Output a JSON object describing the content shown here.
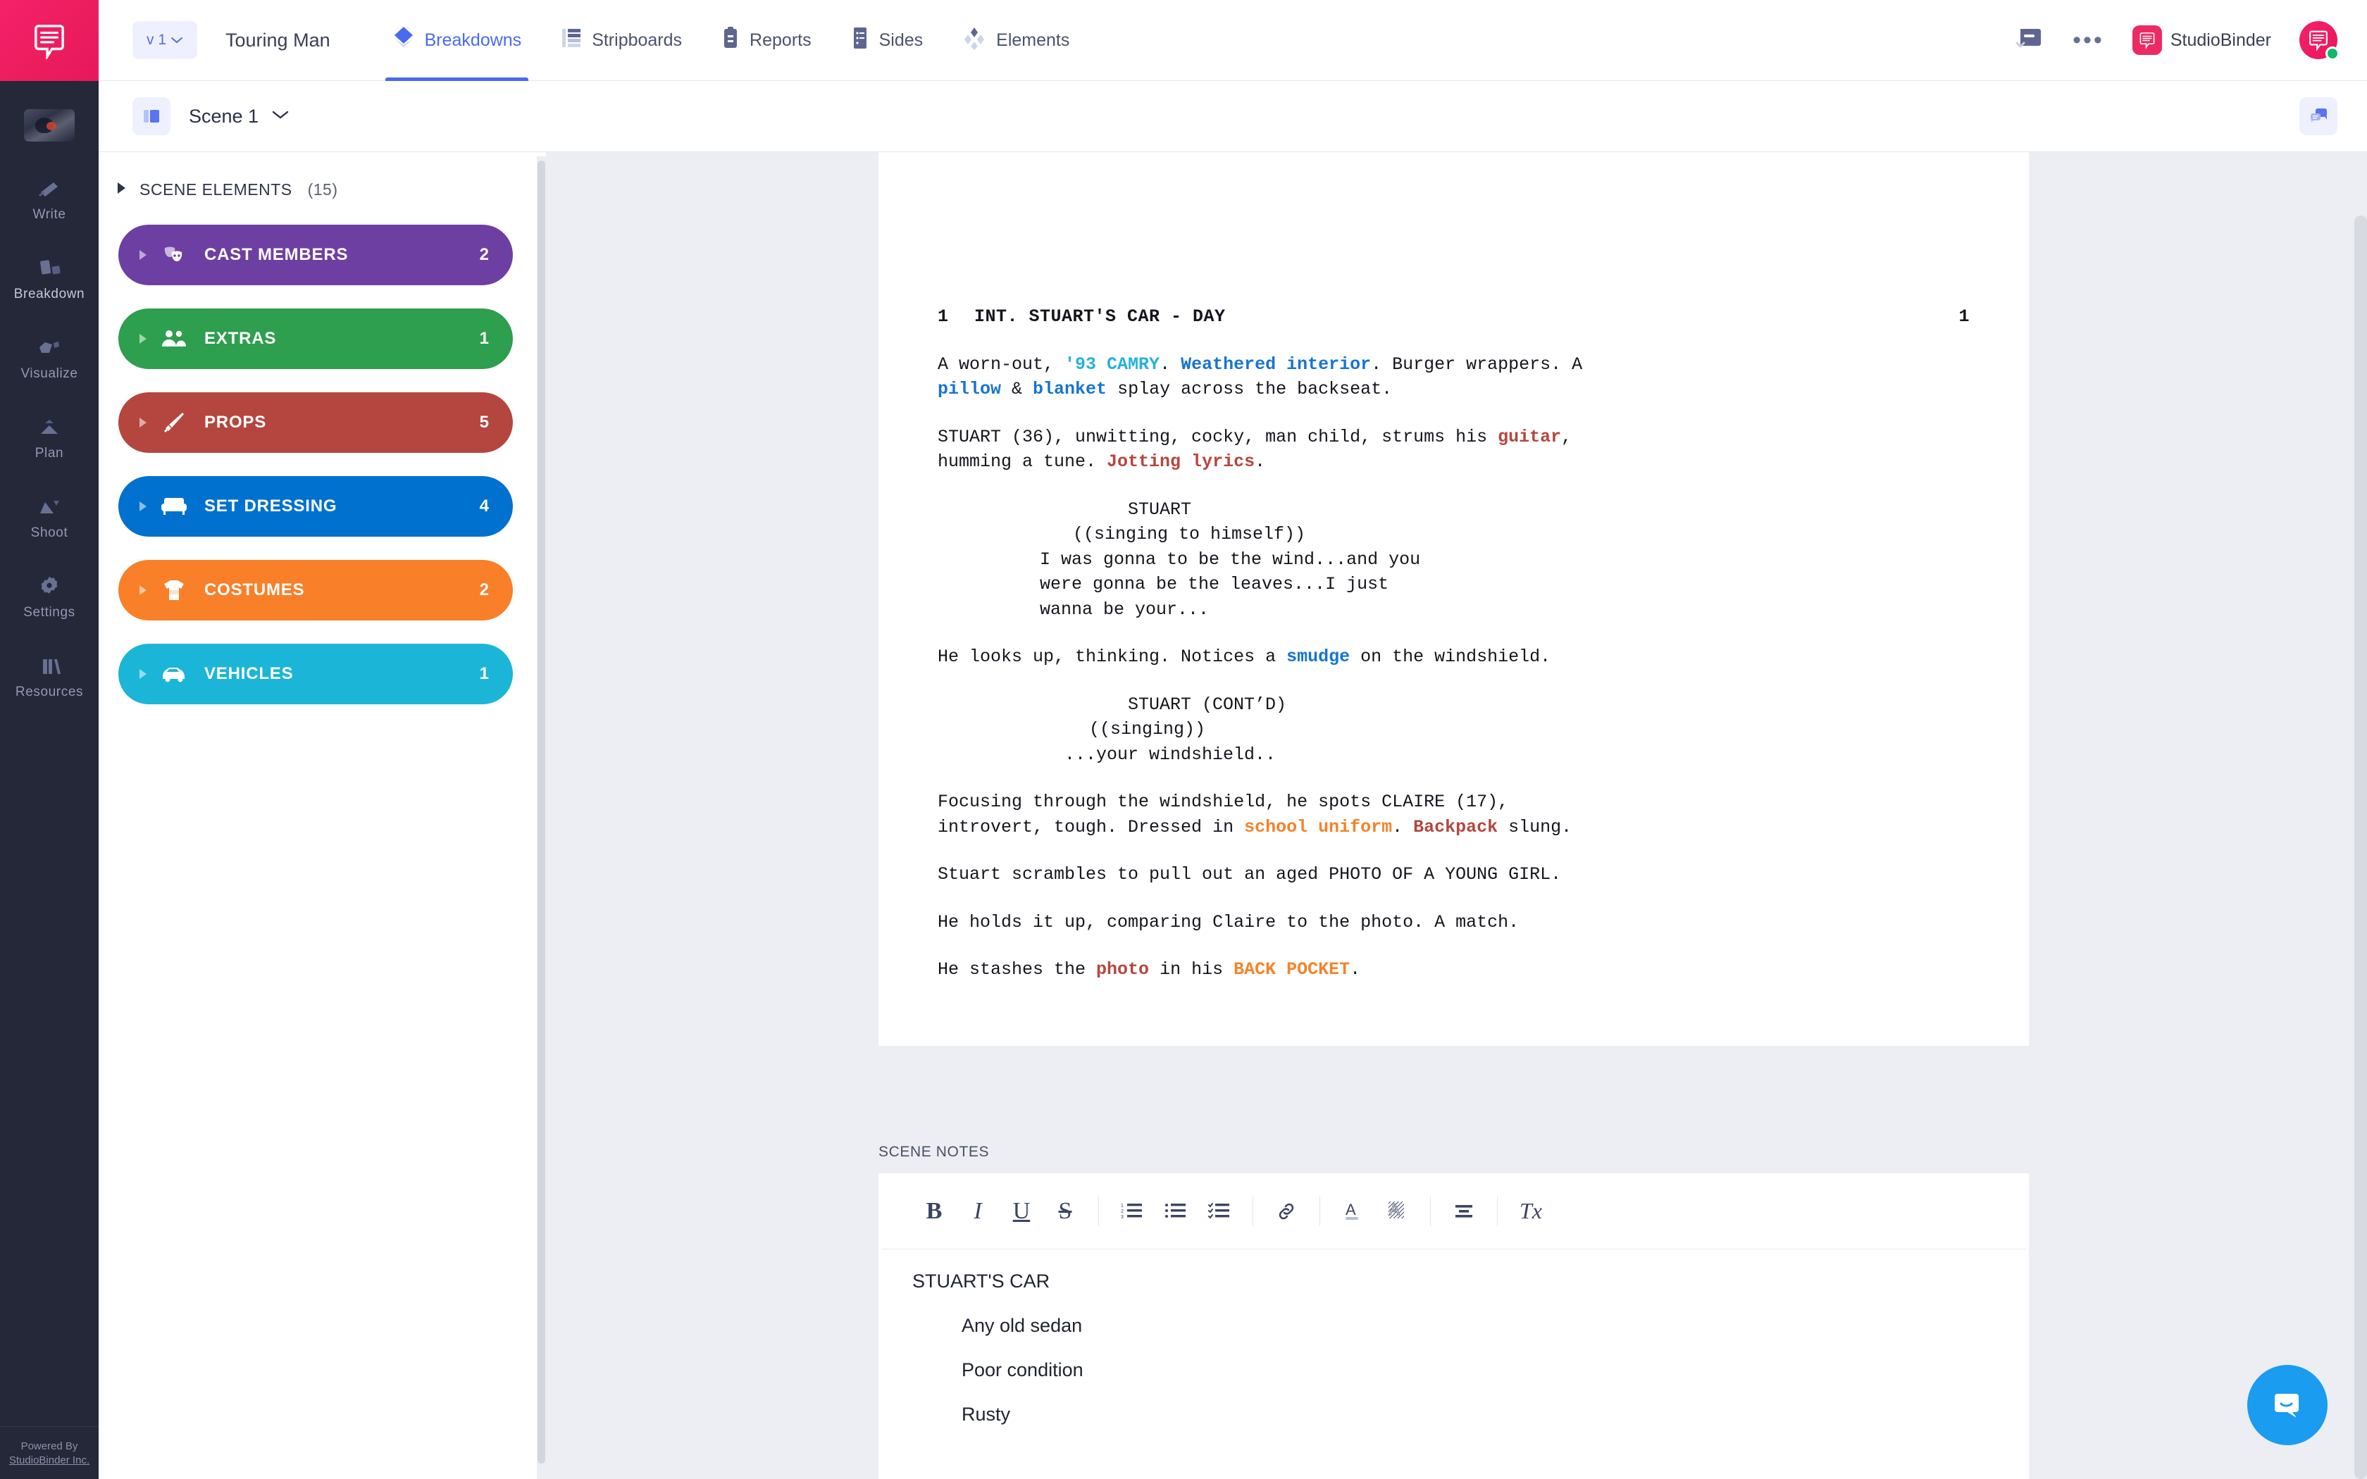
{
  "rail": {
    "logo_icon": "studiobinder-logo-icon",
    "thumbnail_name": "project-thumbnail",
    "items": [
      {
        "label": "Write",
        "icon": "write-icon"
      },
      {
        "label": "Breakdown",
        "icon": "breakdown-icon"
      },
      {
        "label": "Visualize",
        "icon": "visualize-icon"
      },
      {
        "label": "Plan",
        "icon": "plan-icon"
      },
      {
        "label": "Shoot",
        "icon": "shoot-icon"
      },
      {
        "label": "Settings",
        "icon": "gear-icon"
      },
      {
        "label": "Resources",
        "icon": "resources-icon"
      }
    ],
    "footer_line1": "Powered By",
    "footer_line2": "StudioBinder Inc."
  },
  "topbar": {
    "version_label": "v 1",
    "project_title": "Touring Man",
    "nav": [
      {
        "label": "Breakdowns",
        "icon": "diamond-icon",
        "active": true
      },
      {
        "label": "Stripboards",
        "icon": "stripboard-icon",
        "active": false
      },
      {
        "label": "Reports",
        "icon": "clipboard-icon",
        "active": false
      },
      {
        "label": "Sides",
        "icon": "sides-icon",
        "active": false
      },
      {
        "label": "Elements",
        "icon": "elements-icon",
        "active": false
      }
    ],
    "notification_icon": "inbox-check-icon",
    "more_label": "•••",
    "account_name": "StudioBinder",
    "account_chip_icon": "studiobinder-mark-icon",
    "avatar_icon": "user-avatar",
    "accent_color": "#4a6af0",
    "brand_color": "#ec2a63"
  },
  "scenebar": {
    "icon": "scene-card-icon",
    "scene_label": "Scene 1",
    "chevron_icon": "chevron-down-icon",
    "comments_icon": "comments-icon"
  },
  "elements_panel": {
    "header_label": "SCENE ELEMENTS",
    "header_count": "(15)",
    "expand_icon": "triangle-right-icon",
    "categories": [
      {
        "label": "CAST MEMBERS",
        "count": "2",
        "color": "#6e3fa3",
        "icon": "masks-icon"
      },
      {
        "label": "EXTRAS",
        "count": "1",
        "color": "#2e9e4f",
        "icon": "people-icon"
      },
      {
        "label": "PROPS",
        "count": "5",
        "color": "#b5463f",
        "icon": "sword-icon"
      },
      {
        "label": "SET DRESSING",
        "count": "4",
        "color": "#0071ce",
        "icon": "sofa-icon"
      },
      {
        "label": "COSTUMES",
        "count": "2",
        "color": "#f97f28",
        "icon": "shirt-icon"
      },
      {
        "label": "VEHICLES",
        "count": "1",
        "color": "#1bb5d8",
        "icon": "car-icon"
      }
    ]
  },
  "script": {
    "scene_number_left": "1",
    "scene_number_right": "1",
    "heading": "INT. STUART'S CAR - DAY",
    "blocks": [
      {
        "type": "action",
        "parts": [
          {
            "t": "A worn-out, ",
            "c": ""
          },
          {
            "t": "'93 CAMRY",
            "c": "c-cyan"
          },
          {
            "t": ". ",
            "c": ""
          },
          {
            "t": "Weathered interior",
            "c": "c-blue"
          },
          {
            "t": ". Burger wrappers. A\n",
            "c": ""
          },
          {
            "t": "pillow",
            "c": "c-blue"
          },
          {
            "t": " & ",
            "c": ""
          },
          {
            "t": "blanket",
            "c": "c-blue"
          },
          {
            "t": " splay across the backseat.",
            "c": ""
          }
        ]
      },
      {
        "type": "action",
        "parts": [
          {
            "t": "STUART (36), unwitting, cocky, man child, strums his ",
            "c": ""
          },
          {
            "t": "guitar",
            "c": "c-red"
          },
          {
            "t": ",\nhumming a tune. ",
            "c": ""
          },
          {
            "t": "Jotting lyrics",
            "c": "c-red"
          },
          {
            "t": ".",
            "c": ""
          }
        ]
      }
    ],
    "dialogue_1": {
      "character": "STUART",
      "parenthetical": "((singing to himself))",
      "lines": [
        "I was gonna to be the wind...and you",
        "were gonna be the leaves...I just",
        "wanna be your..."
      ]
    },
    "action_mid": {
      "parts": [
        {
          "t": "He looks up, thinking. Notices a ",
          "c": ""
        },
        {
          "t": "smudge",
          "c": "c-blue"
        },
        {
          "t": " on the windshield.",
          "c": ""
        }
      ]
    },
    "dialogue_2": {
      "character": "STUART (CONT’D)",
      "parenthetical": "((singing))",
      "lines": [
        "...your windshield.."
      ]
    },
    "tail_blocks": [
      {
        "parts": [
          {
            "t": "Focusing through the windshield, he spots CLAIRE (17),\nintrovert, tough. Dressed in ",
            "c": ""
          },
          {
            "t": "school uniform",
            "c": "c-orange"
          },
          {
            "t": ". ",
            "c": ""
          },
          {
            "t": "Backpack",
            "c": "c-red"
          },
          {
            "t": " slung.",
            "c": ""
          }
        ]
      },
      {
        "parts": [
          {
            "t": "Stuart scrambles to pull out an aged PHOTO OF A YOUNG GIRL.",
            "c": ""
          }
        ]
      },
      {
        "parts": [
          {
            "t": "He holds it up, comparing Claire to the photo. A match.",
            "c": ""
          }
        ]
      },
      {
        "parts": [
          {
            "t": "He stashes the ",
            "c": ""
          },
          {
            "t": "photo",
            "c": "c-red"
          },
          {
            "t": " in his ",
            "c": ""
          },
          {
            "t": "BACK POCKET",
            "c": "c-orange"
          },
          {
            "t": ".",
            "c": ""
          }
        ]
      }
    ]
  },
  "scene_notes": {
    "section_label": "SCENE NOTES",
    "toolbar": [
      {
        "icon": "bold-icon",
        "label": "B"
      },
      {
        "icon": "italic-icon",
        "label": "I"
      },
      {
        "icon": "underline-icon",
        "label": "U"
      },
      {
        "icon": "strikethrough-icon",
        "label": "S"
      },
      {
        "icon": "ordered-list-icon",
        "label": ""
      },
      {
        "icon": "bullet-list-icon",
        "label": ""
      },
      {
        "icon": "checklist-icon",
        "label": ""
      },
      {
        "icon": "link-icon",
        "label": ""
      },
      {
        "icon": "font-color-icon",
        "label": "A"
      },
      {
        "icon": "highlight-color-icon",
        "label": "A"
      },
      {
        "icon": "align-icon",
        "label": ""
      },
      {
        "icon": "clear-format-icon",
        "label": "Tx"
      }
    ],
    "title": "STUART'S CAR",
    "lines": [
      "Any old sedan",
      "Poor condition",
      "Rusty"
    ]
  },
  "intercom": {
    "icon": "intercom-chat-icon",
    "color": "#1a9cf0"
  }
}
